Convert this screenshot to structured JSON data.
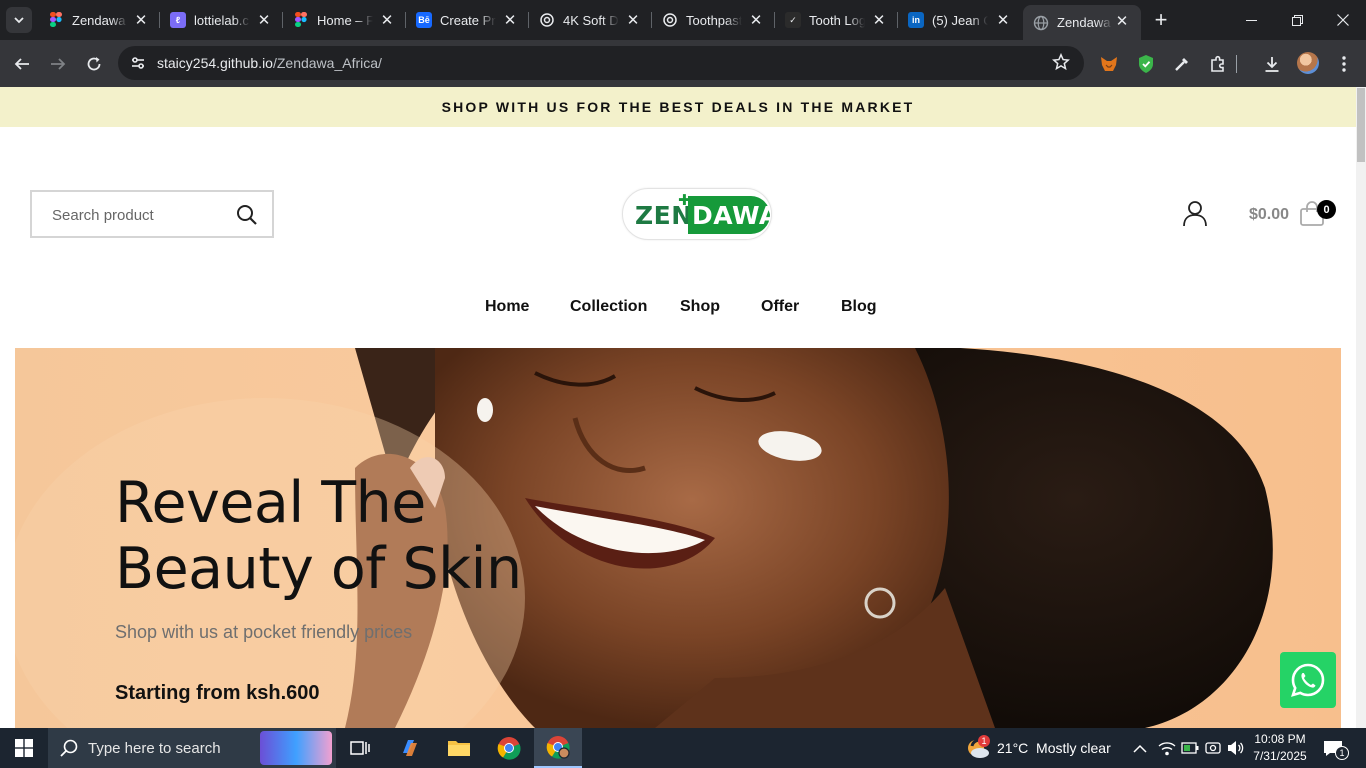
{
  "browser": {
    "tabs": [
      {
        "title": "Zendawa",
        "favicon": "figma-icon",
        "color": "#f24e1e"
      },
      {
        "title": "lottielab.c",
        "favicon": "lottielab-icon",
        "color": "#7b6cf6"
      },
      {
        "title": "Home – F",
        "favicon": "figma-icon",
        "color": "#f24e1e"
      },
      {
        "title": "Create Pro",
        "favicon": "behance-icon",
        "color": "#1769ff"
      },
      {
        "title": "4K Soft D",
        "favicon": "openai-icon",
        "color": "#e8eaed"
      },
      {
        "title": "Toothpast",
        "favicon": "openai-icon",
        "color": "#e8eaed"
      },
      {
        "title": "Tooth Log",
        "favicon": "brand-icon",
        "color": "#e8eaed"
      },
      {
        "title": "(5) Jean C",
        "favicon": "linkedin-icon",
        "color": "#0a66c2"
      },
      {
        "title": "Zendawa",
        "favicon": "globe-icon",
        "color": "#9aa0a6"
      }
    ],
    "url_host": "staicy254.github.io",
    "url_path": "/Zendawa_Africa/"
  },
  "site": {
    "promo": "SHOP WITH US FOR THE BEST DEALS IN THE MARKET",
    "search_placeholder": "Search product",
    "logo_left": "ZEN",
    "logo_right": "DAWA",
    "cart_total": "$0.00",
    "cart_count": "0",
    "nav": [
      "Home",
      "Collection",
      "Shop",
      "Offer",
      "Blog"
    ],
    "hero": {
      "title_line1": "Reveal The",
      "title_line2": "Beauty of Skin",
      "subtitle": "Shop with us at pocket friendly prices",
      "price": "Starting from ksh.600"
    }
  },
  "taskbar": {
    "search_text": "Type here to search",
    "weather": "21°C  Mostly clear",
    "weather_badge": "1",
    "time": "10:08 PM",
    "date": "7/31/2025",
    "notification_count": "1"
  }
}
